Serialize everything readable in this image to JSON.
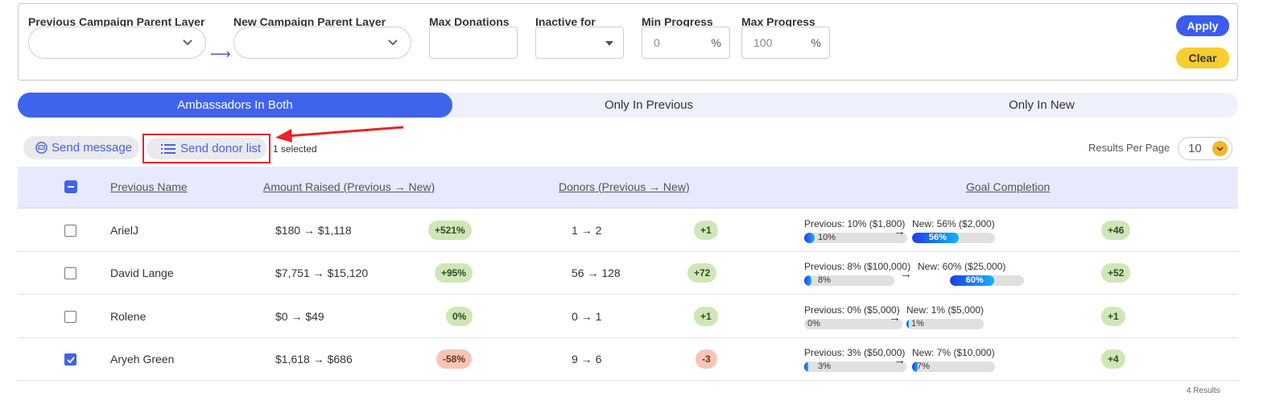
{
  "filters": {
    "prev_parent_label": "Previous Campaign Parent Layer",
    "new_parent_label": "New Campaign Parent Layer",
    "max_donations_label": "Max Donations",
    "inactive_label": "Inactive for",
    "min_progress_label": "Min Progress",
    "min_progress_value": "0",
    "max_progress_label": "Max Progress",
    "max_progress_value": "100",
    "percent": "%",
    "arrow": "⟶",
    "apply_label": "Apply",
    "clear_label": "Clear"
  },
  "tabs": [
    {
      "label": "Ambassadors In Both",
      "active": true
    },
    {
      "label": "Only In Previous",
      "active": false
    },
    {
      "label": "Only In New",
      "active": false
    }
  ],
  "actions": {
    "send_message": "Send message",
    "send_donor_list": "Send donor list",
    "selected": "1 selected",
    "results_per_page_label": "Results Per Page",
    "results_per_page_value": "10"
  },
  "table": {
    "headers": {
      "name": "Previous Name",
      "amount": "Amount Raised (Previous → New)",
      "donors": "Donors (Previous → New)",
      "goal": "Goal Completion"
    },
    "rows": [
      {
        "checked": false,
        "name": "ArielJ",
        "amount": "$180  →  $1,118",
        "amount_change": "+521%",
        "amount_trend": "pos",
        "donors": "1  →  2",
        "donors_change": "+1",
        "donors_trend": "pos",
        "goal_prev": "Previous: 10% ($1,800)",
        "goal_prev_pct": 10,
        "goal_prev_label": "10%",
        "goal_new": "New: 56% ($2,000)",
        "goal_new_pct": 56,
        "goal_new_label": "56%",
        "goal_change": "+46"
      },
      {
        "checked": false,
        "name": "David Lange",
        "amount": "$7,751  →  $15,120",
        "amount_change": "+95%",
        "amount_trend": "pos",
        "donors": "56  →  128",
        "donors_change": "+72",
        "donors_trend": "pos",
        "goal_prev": "Previous: 8% ($100,000)",
        "goal_prev_pct": 8,
        "goal_prev_label": "8%",
        "goal_new": "New: 60% ($25,000)",
        "goal_new_pct": 60,
        "goal_new_label": "60%",
        "goal_change": "+52"
      },
      {
        "checked": false,
        "name": "Rolene",
        "amount": "$0  →  $49",
        "amount_change": "0%",
        "amount_trend": "pos",
        "donors": "0  →  1",
        "donors_change": "+1",
        "donors_trend": "pos",
        "goal_prev": "Previous: 0% ($5,000)",
        "goal_prev_pct": 0,
        "goal_prev_label": "0%",
        "goal_new": "New: 1% ($5,000)",
        "goal_new_pct": 1,
        "goal_new_label": "1%",
        "goal_change": "+1"
      },
      {
        "checked": true,
        "name": "Aryeh Green",
        "amount": "$1,618  →  $686",
        "amount_change": "-58%",
        "amount_trend": "neg",
        "donors": "9  →  6",
        "donors_change": "-3",
        "donors_trend": "neg",
        "goal_prev": "Previous: 3% ($50,000)",
        "goal_prev_pct": 3,
        "goal_prev_label": "3%",
        "goal_new": "New: 7% ($10,000)",
        "goal_new_pct": 7,
        "goal_new_label": "7%",
        "goal_change": "+4"
      }
    ]
  },
  "footer": {
    "results": "4 Results"
  },
  "colors": {
    "accent": "#3b5cf0",
    "clear": "#f8cd2f",
    "positive": "#cfe6b6",
    "negative": "#f7c5b6",
    "annotation": "#e5262a"
  }
}
